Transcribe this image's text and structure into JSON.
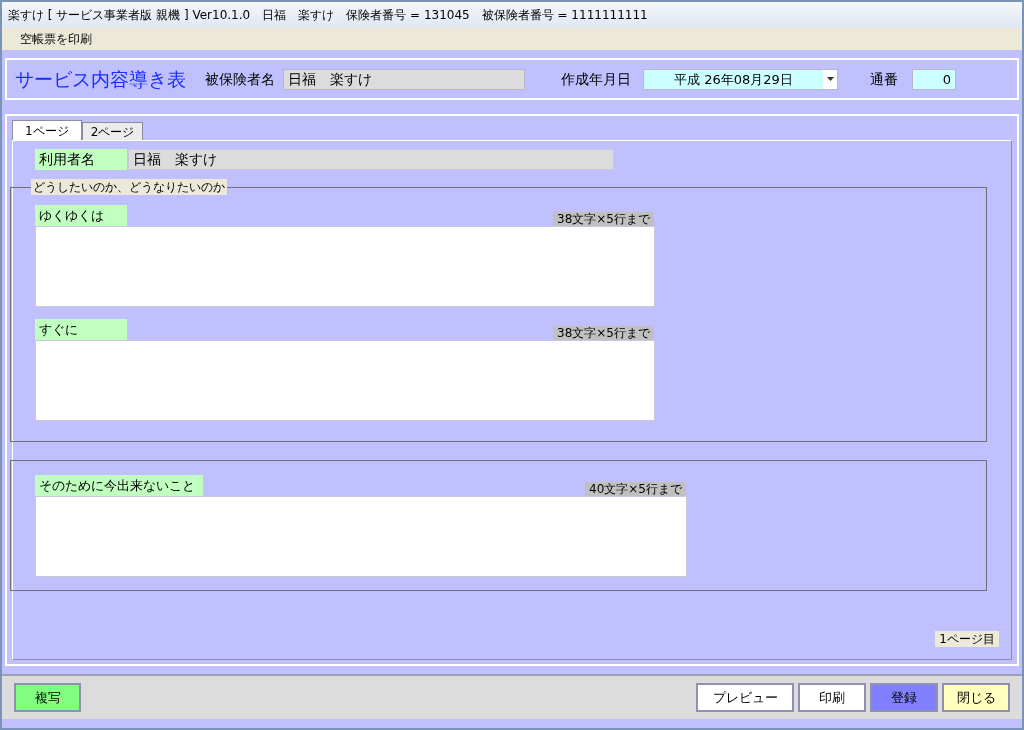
{
  "window": {
    "title": "楽すけ [ サービス事業者版 親機 ] Ver10.1.0　日福　楽すけ　保険者番号 = 131045　被保険者番号 = 1111111111"
  },
  "menu": [
    "空帳票を印刷"
  ],
  "header": {
    "title": "サービス内容導き表",
    "insured_label": "被保険者名",
    "insured_value": "日福　楽すけ",
    "date_label": "作成年月日",
    "date_value": "平成 26年08月29日",
    "serial_label": "通番",
    "serial_value": "0"
  },
  "tabs": [
    {
      "label": "1ページ",
      "selected": true
    },
    {
      "label": "2ページ",
      "selected": false
    }
  ],
  "user": {
    "label": "利用者名",
    "value": "日福　楽すけ"
  },
  "groups": [
    {
      "legend": "どうしたいのか、どうなりたいのか",
      "fields": [
        {
          "label": "ゆくゆくは",
          "limit": "38文字×5行まで"
        },
        {
          "label": "すぐに",
          "limit": "38文字×5行まで"
        }
      ]
    },
    {
      "fields": [
        {
          "label": "そのために今出来ないこと",
          "limit": "40文字×5行まで"
        }
      ]
    }
  ],
  "page_indicator": "1ページ目",
  "buttons": [
    {
      "label": "複写",
      "color": "#80ff80"
    },
    {
      "label": "プレビュー",
      "color": "#ffffff"
    },
    {
      "label": "印刷",
      "color": "#ffffff"
    },
    {
      "label": "登録",
      "color": "#8080ff"
    },
    {
      "label": "閉じる",
      "color": "#ffffc0"
    }
  ]
}
